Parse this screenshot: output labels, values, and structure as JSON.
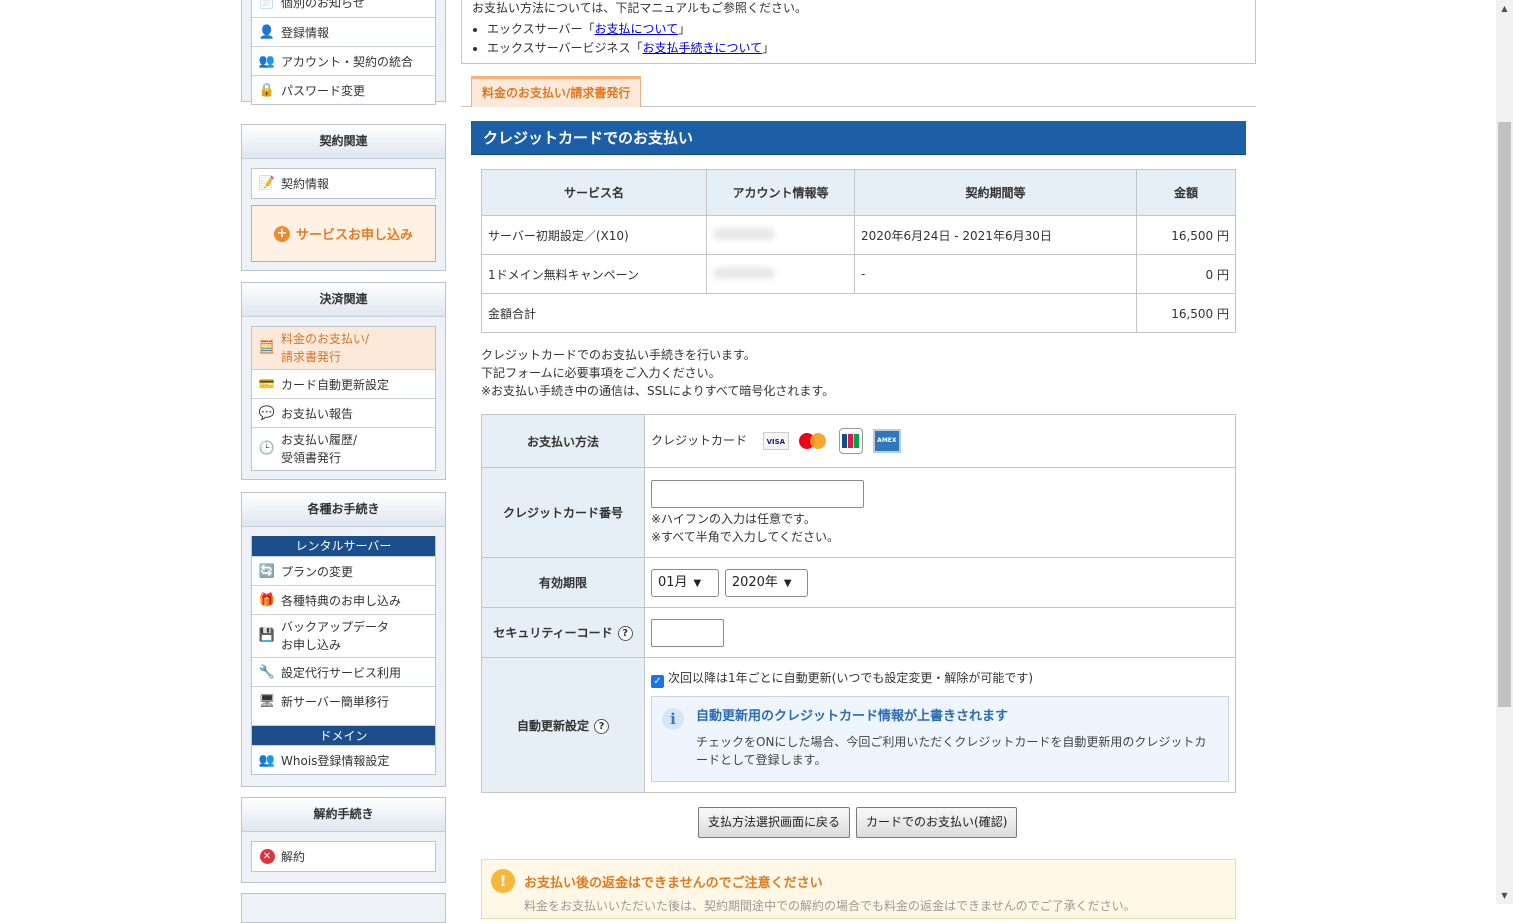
{
  "sidebar": {
    "account_items": [
      "個別のお知らせ",
      "登録情報",
      "アカウント・契約の統合",
      "パスワード変更"
    ],
    "contract": {
      "title": "契約関連",
      "items": [
        "契約情報"
      ],
      "apply_button": "サービスお申し込み"
    },
    "payment": {
      "title": "決済関連",
      "items": [
        "料金のお支払い/\n請求書発行",
        "カード自動更新設定",
        "お支払い報告",
        "お支払い履歴/\n受領書発行"
      ]
    },
    "procedures": {
      "title": "各種お手続き",
      "rental_server_label": "レンタルサーバー",
      "rental_items": [
        "プランの変更",
        "各種特典のお申し込み",
        "バックアップデータ\nお申し込み",
        "設定代行サービス利用",
        "新サーバー簡単移行"
      ],
      "domain_label": "ドメイン",
      "domain_items": [
        "Whois登録情報設定"
      ]
    },
    "cancel": {
      "title": "解約手続き",
      "items": [
        "解約"
      ]
    }
  },
  "notice": {
    "line1": "お支払い方法については、下記マニュアルもご参照ください。",
    "item1_prefix": "エックスサーバー「",
    "item1_link": "お支払について",
    "item1_suffix": "」",
    "item2_prefix": "エックスサーバービジネス「",
    "item2_link": "お支払手続きについて",
    "item2_suffix": "」"
  },
  "tab": {
    "label": "料金のお支払い/請求書発行"
  },
  "section_title": "クレジットカードでのお支払い",
  "services": {
    "headers": [
      "サービス名",
      "アカウント情報等",
      "契約期間等",
      "金額"
    ],
    "rows": [
      {
        "name": "サーバー初期設定／(X10)",
        "period": "2020年6月24日 - 2021年6月30日",
        "amount": "16,500 円"
      },
      {
        "name": "1ドメイン無料キャンペーン",
        "period": "-",
        "amount": "0 円"
      }
    ],
    "total_label": "金額合計",
    "total_amount": "16,500 円"
  },
  "description": [
    "クレジットカードでのお支払い手続きを行います。",
    "下記フォームに必要事項をご入力ください。",
    "※お支払い手続き中の通信は、SSLによりすべて暗号化されます。"
  ],
  "form": {
    "method_label": "お支払い方法",
    "method_value": "クレジットカード",
    "card_names": [
      "VISA",
      "MasterCard",
      "JCB",
      "AMERICAN EXPRESS"
    ],
    "card_number_label": "クレジットカード番号",
    "card_number_value": "",
    "card_notes": [
      "※ハイフンの入力は任意です。",
      "※すべて半角で入力してください。"
    ],
    "expiry_label": "有効期限",
    "expiry_month": "01月",
    "expiry_year": "2020年",
    "security_label": "セキュリティーコード",
    "security_value": "",
    "auto_label": "自動更新設定",
    "auto_checked": true,
    "auto_checkbox_text": "次回以降は1年ごとに自動更新(いつでも設定変更・解除が可能です)",
    "info_title": "自動更新用のクレジットカード情報が上書きされます",
    "info_body": "チェックをONにした場合、今回ご利用いただくクレジットカードを自動更新用のクレジットカードとして登録します。"
  },
  "buttons": {
    "back": "支払方法選択画面に戻る",
    "confirm": "カードでのお支払い(確認)"
  },
  "warning": {
    "title": "お支払い後の返金はできませんのでご注意ください",
    "body": "料金をお支払いいただいた後は、契約期間途中での解約の場合でも料金の返金はできませんのでご了承ください。"
  },
  "colors": {
    "section_blue": "#1d5fa6",
    "accent_orange": "#e87a1e",
    "header_bg": "#e6eef6"
  }
}
